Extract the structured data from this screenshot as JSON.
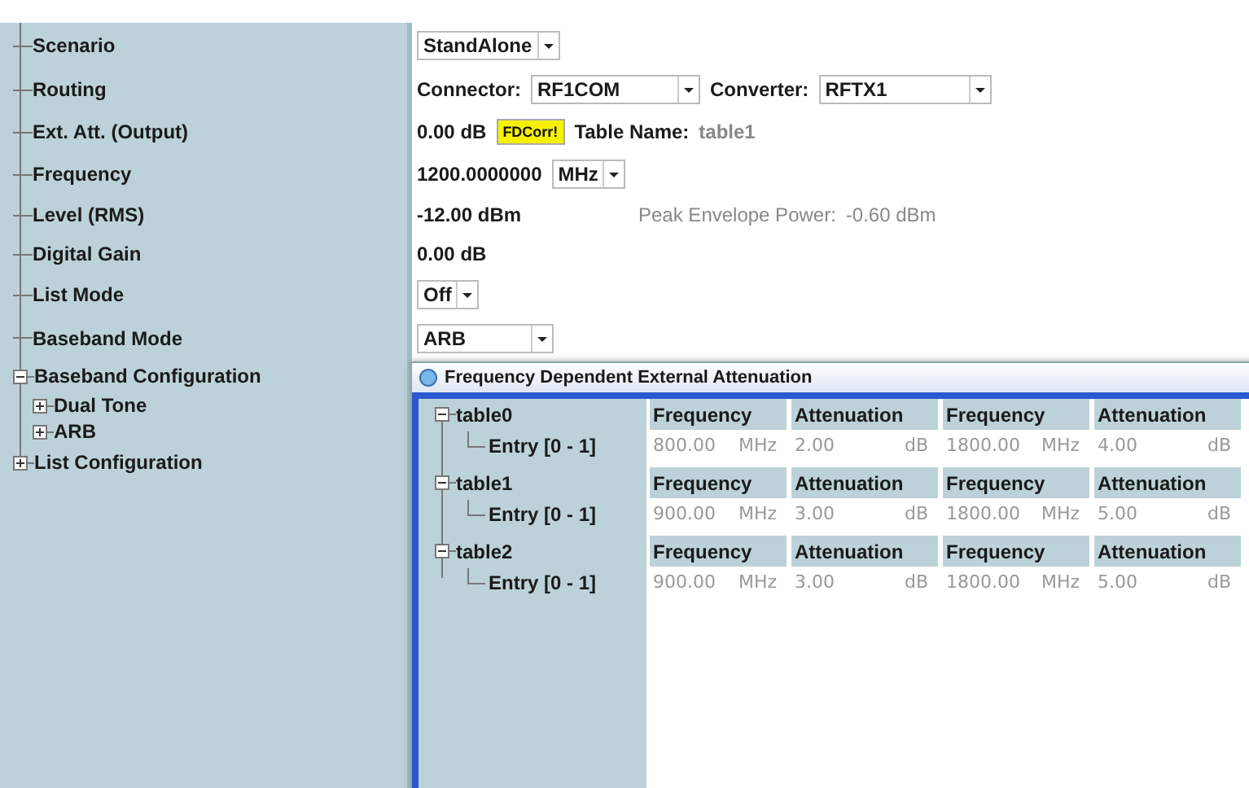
{
  "sidebar": {
    "items": [
      {
        "label": "Scenario",
        "kind": "leaf"
      },
      {
        "label": "Routing",
        "kind": "leaf"
      },
      {
        "label": "Ext. Att. (Output)",
        "kind": "leaf"
      },
      {
        "label": "Frequency",
        "kind": "leaf"
      },
      {
        "label": "Level (RMS)",
        "kind": "leaf"
      },
      {
        "label": "Digital Gain",
        "kind": "leaf"
      },
      {
        "label": "List Mode",
        "kind": "leaf"
      },
      {
        "label": "Baseband Mode",
        "kind": "leaf"
      },
      {
        "label": "Baseband Configuration",
        "kind": "branch",
        "expanded": true,
        "children": [
          {
            "label": "Dual Tone",
            "kind": "branch",
            "expanded": false
          },
          {
            "label": "ARB",
            "kind": "branch",
            "expanded": false
          }
        ]
      },
      {
        "label": "List Configuration",
        "kind": "branch",
        "expanded": false
      }
    ]
  },
  "settings": [
    {
      "kind": "dropdown",
      "value": "StandAlone"
    },
    {
      "kind": "routing",
      "connector_label": "Connector:",
      "connector": "RF1COM",
      "converter_label": "Converter:",
      "converter": "RFTX1"
    },
    {
      "kind": "attenuation",
      "value": "0.00 dB",
      "button": "FDCorr!",
      "table_label": "Table Name:",
      "table": "table1"
    },
    {
      "kind": "frequency",
      "value": "1200.0000000",
      "unit": "MHz"
    },
    {
      "kind": "level",
      "value": "-12.00 dBm",
      "pep_label": "Peak Envelope Power:",
      "pep": "-0.60 dBm"
    },
    {
      "kind": "text",
      "value": "0.00 dB"
    },
    {
      "kind": "dropdown",
      "value": "Off"
    },
    {
      "kind": "dropdown",
      "value": "ARB",
      "wide": true
    }
  ],
  "dialog": {
    "title": "Frequency Dependent External Attenuation",
    "tables": [
      {
        "name": "table0",
        "expanded": true,
        "entry": "Entry [0 - 1]",
        "headers": [
          "Frequency",
          "Attenuation",
          "Frequency",
          "Attenuation"
        ],
        "cells": [
          {
            "value": "800.00",
            "unit": "MHz"
          },
          {
            "value": "2.00",
            "unit": "dB"
          },
          {
            "value": "1800.00",
            "unit": "MHz"
          },
          {
            "value": "4.00",
            "unit": "dB"
          }
        ]
      },
      {
        "name": "table1",
        "expanded": true,
        "entry": "Entry [0 - 1]",
        "headers": [
          "Frequency",
          "Attenuation",
          "Frequency",
          "Attenuation"
        ],
        "cells": [
          {
            "value": "900.00",
            "unit": "MHz"
          },
          {
            "value": "3.00",
            "unit": "dB"
          },
          {
            "value": "1800.00",
            "unit": "MHz"
          },
          {
            "value": "5.00",
            "unit": "dB"
          }
        ]
      },
      {
        "name": "table2",
        "expanded": true,
        "entry": "Entry [0 - 1]",
        "headers": [
          "Frequency",
          "Attenuation",
          "Frequency",
          "Attenuation"
        ],
        "cells": [
          {
            "value": "900.00",
            "unit": "MHz"
          },
          {
            "value": "3.00",
            "unit": "dB"
          },
          {
            "value": "1800.00",
            "unit": "MHz"
          },
          {
            "value": "5.00",
            "unit": "dB"
          }
        ]
      }
    ]
  }
}
